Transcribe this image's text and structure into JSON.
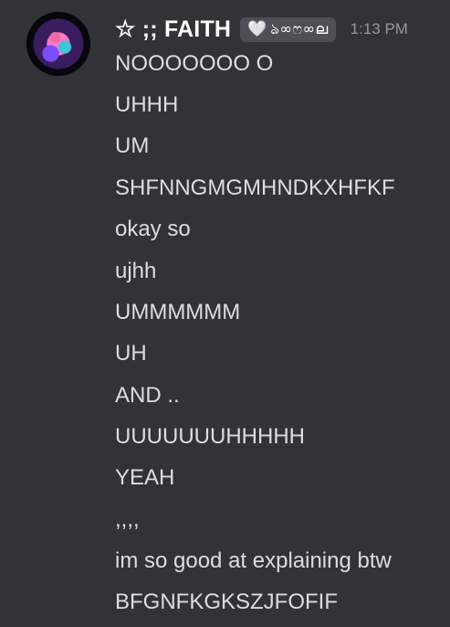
{
  "message": {
    "author": "☆ ;; FAITH",
    "tag": {
      "heart": "🤍",
      "text": "ঌ∞ෆ∞ല"
    },
    "timestamp": "1:13 PM",
    "lines": [
      "NOOOOOOO O",
      "UHHH",
      "UM",
      "SHFNNGMGMHNDKXHFKF",
      "okay so",
      "ujhh",
      "UMMMMMM",
      "UH",
      "AND ..",
      "UUUUUUUHHHHH",
      "YEAH",
      ",,,,",
      "im so good at explaining btw",
      "BFGNFKGKSZJFOFIF"
    ]
  }
}
